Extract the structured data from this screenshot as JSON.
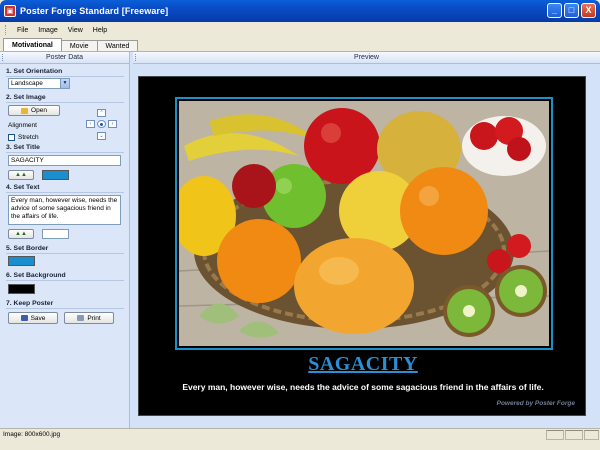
{
  "window": {
    "title": "Poster Forge Standard [Freeware]",
    "controls": [
      "_",
      "□",
      "X"
    ]
  },
  "menu": {
    "items": [
      {
        "label": "File"
      },
      {
        "label": "Image"
      },
      {
        "label": "View"
      },
      {
        "label": "Help"
      }
    ]
  },
  "tabs": [
    {
      "label": "Motivational",
      "active": true
    },
    {
      "label": "Movie",
      "active": false
    },
    {
      "label": "Wanted",
      "active": false
    }
  ],
  "left_panel": {
    "header": "Poster Data",
    "orientation": {
      "heading": "1. Set Orientation",
      "value": "Landscape"
    },
    "image": {
      "heading": "2. Set Image",
      "open_label": "Open",
      "alignment_label": "Alignment",
      "stretch_label": "Stretch",
      "stretch_checked": false
    },
    "title": {
      "heading": "3. Set Title",
      "value": "SAGACITY",
      "color": "#1a8fd0"
    },
    "text": {
      "heading": "4. Set Text",
      "value": "Every man, however wise, needs the advice of some sagacious friend in the affairs of life.",
      "color": "#ffffff"
    },
    "border": {
      "heading": "5. Set Border",
      "color": "#1a8fd0"
    },
    "background": {
      "heading": "6. Set Background",
      "color": "#000000"
    },
    "keep": {
      "heading": "7. Keep Poster",
      "save_label": "Save",
      "print_label": "Print"
    }
  },
  "preview": {
    "header": "Preview",
    "title": "SAGACITY",
    "text": "Every man, however wise, needs the advice of some sagacious friend in the affairs of life.",
    "credit": "Powered by Poster Forge"
  },
  "status": {
    "text": "Image: 800x600.jpg"
  }
}
